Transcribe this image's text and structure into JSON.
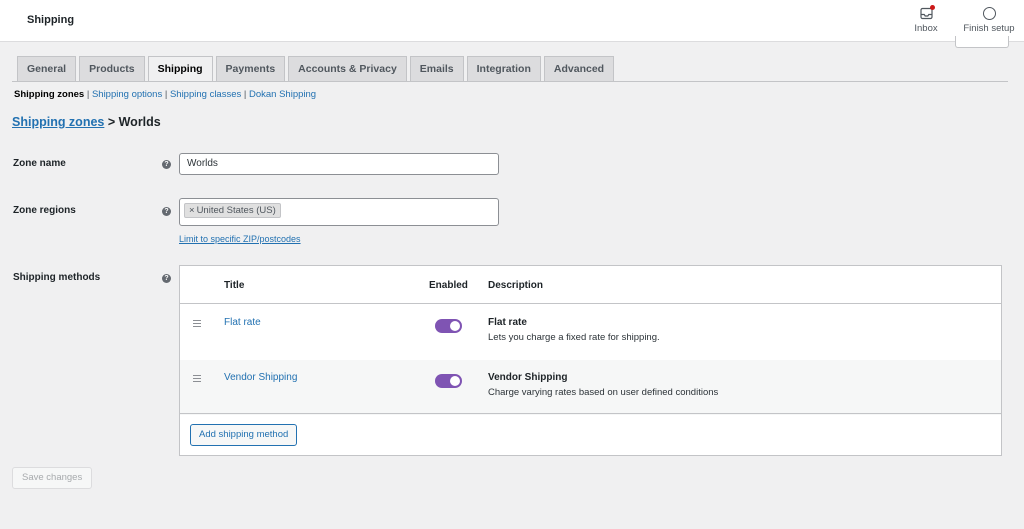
{
  "topbar": {
    "title": "Shipping",
    "inbox_label": "Inbox",
    "finish_label": "Finish setup"
  },
  "tabs": [
    {
      "label": "General"
    },
    {
      "label": "Products"
    },
    {
      "label": "Shipping",
      "active": true
    },
    {
      "label": "Payments"
    },
    {
      "label": "Accounts & Privacy"
    },
    {
      "label": "Emails"
    },
    {
      "label": "Integration"
    },
    {
      "label": "Advanced"
    }
  ],
  "subnav": {
    "current": "Shipping zones",
    "links": [
      "Shipping options",
      "Shipping classes",
      "Dokan Shipping"
    ]
  },
  "heading": {
    "link": "Shipping zones",
    "rest": " > Worlds"
  },
  "form": {
    "zone_name_label": "Zone name",
    "zone_name_value": "Worlds",
    "zone_regions_label": "Zone regions",
    "region_chip": "United States (US)",
    "limit_link": "Limit to specific ZIP/postcodes",
    "methods_label": "Shipping methods"
  },
  "methods": {
    "headers": {
      "title": "Title",
      "enabled": "Enabled",
      "description": "Description"
    },
    "rows": [
      {
        "title": "Flat rate",
        "enabled": true,
        "desc_title": "Flat rate",
        "desc": "Lets you charge a fixed rate for shipping."
      },
      {
        "title": "Vendor Shipping",
        "enabled": true,
        "desc_title": "Vendor Shipping",
        "desc": "Charge varying rates based on user defined conditions"
      }
    ],
    "add_label": "Add shipping method"
  },
  "save_label": "Save changes",
  "colors": {
    "accent": "#2271b1",
    "toggle_on": "#7f54b3",
    "notification": "#cc1818"
  }
}
